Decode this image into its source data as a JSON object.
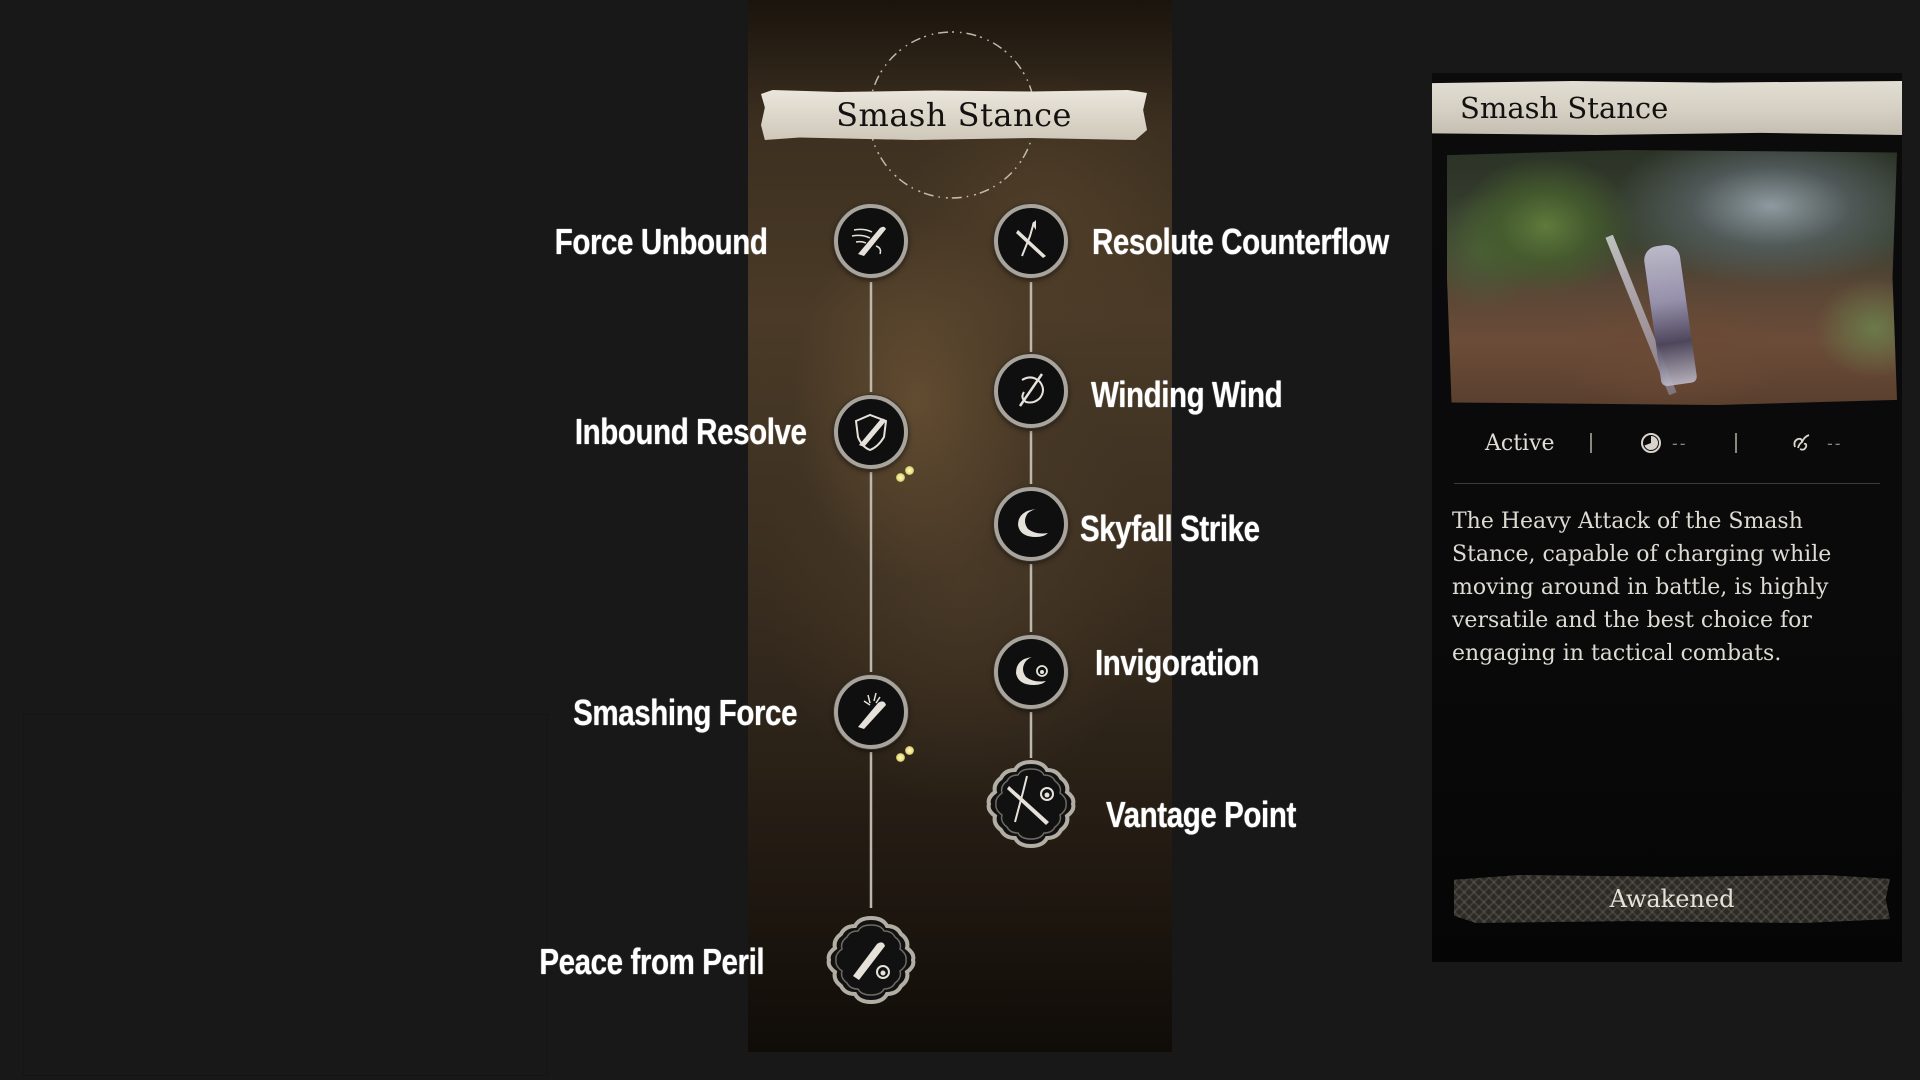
{
  "skill_tree": {
    "title": "Smash Stance",
    "left_branch": [
      {
        "id": "force-unbound",
        "label": "Force Unbound",
        "icon": "club-wind-icon",
        "frame": "circle"
      },
      {
        "id": "inbound-resolve",
        "label": "Inbound Resolve",
        "icon": "club-shield-icon",
        "frame": "circle",
        "indicator_dots": 2
      },
      {
        "id": "smashing-force",
        "label": "Smashing Force",
        "icon": "club-burst-icon",
        "frame": "circle",
        "indicator_dots": 2
      },
      {
        "id": "peace-from-peril",
        "label": "Peace from Peril",
        "icon": "club-flame-icon",
        "frame": "ornate"
      }
    ],
    "right_branch": [
      {
        "id": "resolute-counterflow",
        "label": "Resolute Counterflow",
        "icon": "crossed-weapons-icon",
        "frame": "circle"
      },
      {
        "id": "winding-wind",
        "label": "Winding Wind",
        "icon": "swirl-slash-icon",
        "frame": "circle"
      },
      {
        "id": "skyfall-strike",
        "label": "Skyfall Strike",
        "icon": "crescent-arc-icon",
        "frame": "circle"
      },
      {
        "id": "invigoration",
        "label": "Invigoration",
        "icon": "crescent-flame-icon",
        "frame": "circle"
      },
      {
        "id": "vantage-point",
        "label": "Vantage Point",
        "icon": "crossed-weapons-flame-icon",
        "frame": "ornate"
      }
    ]
  },
  "detail_panel": {
    "title": "Smash Stance",
    "preview_image": "gameplay-preview",
    "type_label": "Active",
    "stats": [
      {
        "icon": "cooldown-icon",
        "value": "--"
      },
      {
        "icon": "energy-cost-icon",
        "value": "--"
      }
    ],
    "description": "The Heavy Attack of the Smash Stance, capable of charging while moving around in battle, is highly versatile and the best choice for engaging in tactical combats.",
    "status_button": "Awakened"
  }
}
